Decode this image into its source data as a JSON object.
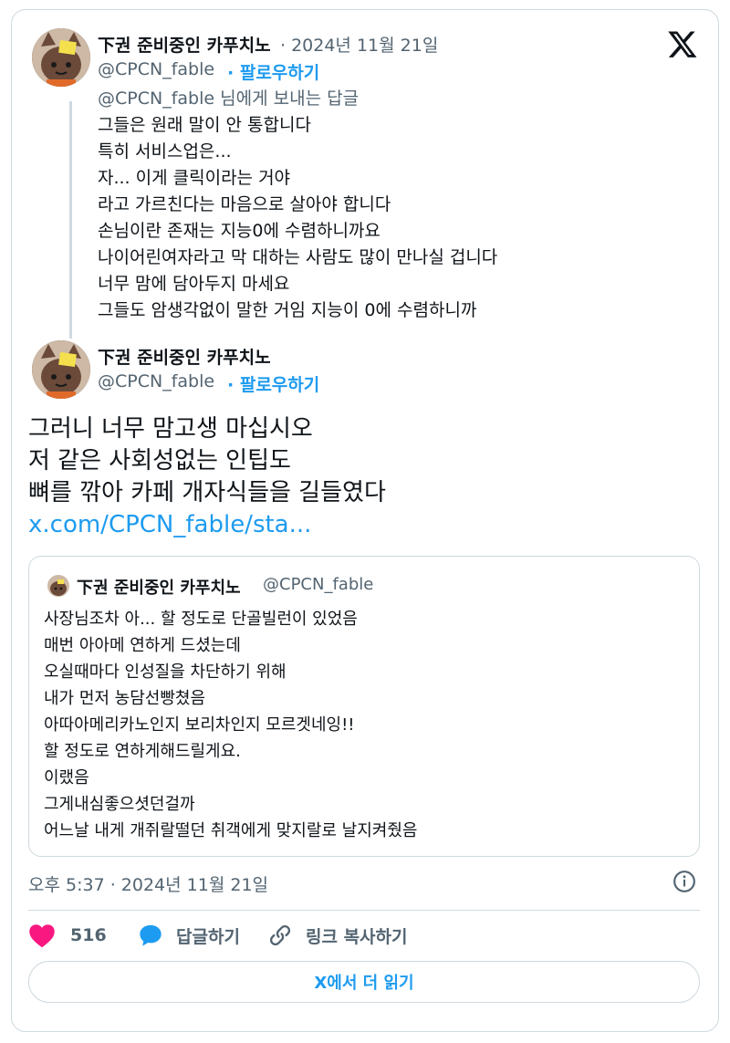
{
  "reply_tweet": {
    "author_name": "下권 준비중인 카푸치노",
    "date": "· 2024년 11월 21일",
    "handle": "@CPCN_fable",
    "follow": "· 팔로우하기",
    "replying_to_handle": "@CPCN_fable",
    "replying_to_suffix": "님에게 보내는 답글",
    "lines": [
      "그들은 원래 말이 안 통합니다",
      "특히 서비스업은...",
      "자... 이게 클릭이라는 거야",
      "라고 가르친다는 마음으로 살아야 합니다",
      "손님이란 존재는 지능0에 수렴하니까요",
      "나이어린여자라고 막 대하는 사람도 많이 만나실 겁니다",
      "너무 맘에 담아두지 마세요",
      "그들도 암생각없이 말한 거임 지능이 0에 수렴하니까"
    ]
  },
  "main_tweet": {
    "author_name": "下권 준비중인 카푸치노",
    "handle": "@CPCN_fable",
    "follow": "· 팔로우하기",
    "lines": [
      "그러니 너무 맘고생 마십시오",
      "저 같은 사회성없는 인팁도",
      "뼈를 깎아 카페 개자식들을 길들였다"
    ],
    "link": "x.com/CPCN_fable/sta...",
    "timestamp": "오후 5:37 · 2024년 11월 21일"
  },
  "quote_tweet": {
    "author_name": "下권 준비중인 카푸치노",
    "handle": "@CPCN_fable",
    "lines": [
      "사장님조차 아... 할 정도로 단골빌런이 있었음",
      "매번 아아메 연하게 드셨는데",
      "오실때마다 인성질을 차단하기 위해",
      "내가 먼저 농담선빵쳤음",
      "아따아메리카노인지 보리차인지 모르겟네잉!!",
      "할 정도로 연하게해드릴게요.",
      "이랬음",
      "그게내심좋으셧던걸까",
      "어느날 내게 개쥐랄떨던 취객에게 맞지랄로 날지켜줬음"
    ]
  },
  "actions": {
    "likes": "516",
    "reply_label": "답글하기",
    "copy_link_label": "링크 복사하기"
  },
  "read_more": "X에서 더 읽기",
  "colors": {
    "accent": "#1d9bf0",
    "like": "#f91880",
    "text": "#0f1419",
    "secondary": "#536471",
    "border": "#cfd9de"
  },
  "icons": {
    "logo": "x-logo-icon",
    "info": "info-icon",
    "like": "heart-icon",
    "reply": "speech-bubble-icon",
    "copy_link": "link-icon"
  }
}
